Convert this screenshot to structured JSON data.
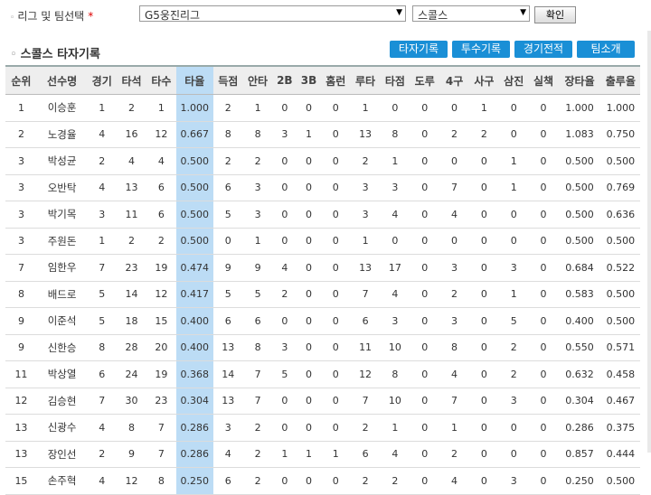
{
  "filter": {
    "label": "리그 및 팀선택",
    "required_mark": "*",
    "league_value": "G5웅진리그",
    "team_value": "스콜스",
    "confirm_label": "확인"
  },
  "section": {
    "title": "스콜스 타자기록",
    "tabs": [
      "타자기록",
      "투수기록",
      "경기전적",
      "팀소개"
    ]
  },
  "table": {
    "headers": [
      "순위",
      "선수명",
      "경기",
      "타석",
      "타수",
      "타율",
      "득점",
      "안타",
      "2B",
      "3B",
      "홈런",
      "루타",
      "타점",
      "도루",
      "4구",
      "사구",
      "삼진",
      "실책",
      "장타율",
      "출루율"
    ],
    "rows": [
      [
        "1",
        "이승훈",
        "1",
        "2",
        "1",
        "1.000",
        "2",
        "1",
        "0",
        "0",
        "0",
        "1",
        "0",
        "0",
        "0",
        "1",
        "0",
        "0",
        "1.000",
        "1.000"
      ],
      [
        "2",
        "노경율",
        "4",
        "16",
        "12",
        "0.667",
        "8",
        "8",
        "3",
        "1",
        "0",
        "13",
        "8",
        "0",
        "2",
        "2",
        "0",
        "0",
        "1.083",
        "0.750"
      ],
      [
        "3",
        "박성균",
        "2",
        "4",
        "4",
        "0.500",
        "2",
        "2",
        "0",
        "0",
        "0",
        "2",
        "1",
        "0",
        "0",
        "0",
        "1",
        "0",
        "0.500",
        "0.500"
      ],
      [
        "3",
        "오반탁",
        "4",
        "13",
        "6",
        "0.500",
        "6",
        "3",
        "0",
        "0",
        "0",
        "3",
        "3",
        "0",
        "7",
        "0",
        "1",
        "0",
        "0.500",
        "0.769"
      ],
      [
        "3",
        "박기목",
        "3",
        "11",
        "6",
        "0.500",
        "5",
        "3",
        "0",
        "0",
        "0",
        "3",
        "4",
        "0",
        "4",
        "0",
        "0",
        "0",
        "0.500",
        "0.636"
      ],
      [
        "3",
        "주원돈",
        "1",
        "2",
        "2",
        "0.500",
        "0",
        "1",
        "0",
        "0",
        "0",
        "1",
        "0",
        "0",
        "0",
        "0",
        "0",
        "0",
        "0.500",
        "0.500"
      ],
      [
        "7",
        "임한우",
        "7",
        "23",
        "19",
        "0.474",
        "9",
        "9",
        "4",
        "0",
        "0",
        "13",
        "17",
        "0",
        "3",
        "0",
        "3",
        "0",
        "0.684",
        "0.522"
      ],
      [
        "8",
        "배드로",
        "5",
        "14",
        "12",
        "0.417",
        "5",
        "5",
        "2",
        "0",
        "0",
        "7",
        "4",
        "0",
        "2",
        "0",
        "1",
        "0",
        "0.583",
        "0.500"
      ],
      [
        "9",
        "이준석",
        "5",
        "18",
        "15",
        "0.400",
        "6",
        "6",
        "0",
        "0",
        "0",
        "6",
        "3",
        "0",
        "3",
        "0",
        "5",
        "0",
        "0.400",
        "0.500"
      ],
      [
        "9",
        "신한승",
        "8",
        "28",
        "20",
        "0.400",
        "13",
        "8",
        "3",
        "0",
        "0",
        "11",
        "10",
        "0",
        "8",
        "0",
        "2",
        "0",
        "0.550",
        "0.571"
      ],
      [
        "11",
        "박상열",
        "6",
        "24",
        "19",
        "0.368",
        "14",
        "7",
        "5",
        "0",
        "0",
        "12",
        "8",
        "0",
        "4",
        "0",
        "2",
        "0",
        "0.632",
        "0.458"
      ],
      [
        "12",
        "김승현",
        "7",
        "30",
        "23",
        "0.304",
        "13",
        "7",
        "0",
        "0",
        "0",
        "7",
        "10",
        "0",
        "7",
        "0",
        "3",
        "0",
        "0.304",
        "0.467"
      ],
      [
        "13",
        "신광수",
        "4",
        "8",
        "7",
        "0.286",
        "3",
        "2",
        "0",
        "0",
        "0",
        "2",
        "1",
        "0",
        "1",
        "0",
        "0",
        "0",
        "0.286",
        "0.375"
      ],
      [
        "13",
        "장인선",
        "2",
        "9",
        "7",
        "0.286",
        "4",
        "2",
        "1",
        "1",
        "1",
        "6",
        "4",
        "0",
        "2",
        "0",
        "0",
        "0",
        "0.857",
        "0.444"
      ],
      [
        "15",
        "손주혁",
        "4",
        "12",
        "8",
        "0.250",
        "6",
        "2",
        "0",
        "0",
        "0",
        "2",
        "2",
        "0",
        "4",
        "0",
        "3",
        "0",
        "0.250",
        "0.500"
      ]
    ]
  }
}
